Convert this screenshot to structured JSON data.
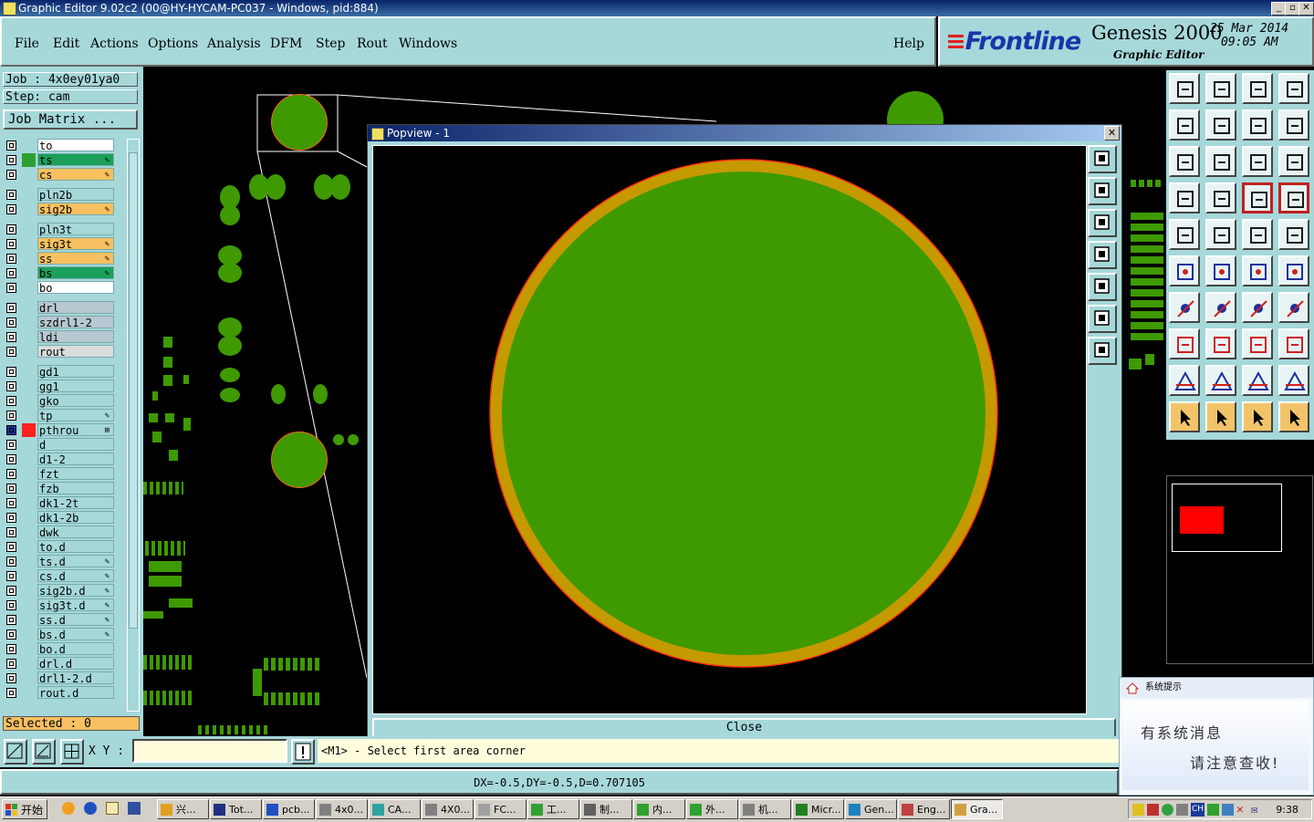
{
  "window": {
    "title": "Graphic Editor 9.02c2 (00@HY-HYCAM-PC037 - Windows, pid:884)"
  },
  "menu": [
    "File",
    "Edit",
    "Actions",
    "Options",
    "Analysis",
    "DFM",
    "Step",
    "Rout",
    "Windows"
  ],
  "help": "Help",
  "brand": {
    "logo": "Frontline",
    "product": "Genesis 2000",
    "subtitle": "Graphic Editor",
    "date": "25 Mar 2014",
    "time": "09:05 AM"
  },
  "job": {
    "job": "Job : 4x0ey01ya0",
    "step": "Step: cam",
    "matrix_button": "Job Matrix ..."
  },
  "layers": [
    {
      "name": "to",
      "color": "#ffffff",
      "swatch": "",
      "flag": ""
    },
    {
      "name": "ts",
      "color": "#1aa05a",
      "swatch": "#2aa030",
      "flag": "✎"
    },
    {
      "name": "cs",
      "color": "#f8c060",
      "swatch": "",
      "flag": "✎"
    },
    {
      "name": "pln2b",
      "color": "#a6d8da",
      "swatch": "",
      "flag": ""
    },
    {
      "name": "sig2b",
      "color": "#f8c060",
      "swatch": "",
      "flag": "✎"
    },
    {
      "name": "pln3t",
      "color": "#a6d8da",
      "swatch": "",
      "flag": ""
    },
    {
      "name": "sig3t",
      "color": "#f8c060",
      "swatch": "",
      "flag": "✎"
    },
    {
      "name": "ss",
      "color": "#f8c060",
      "swatch": "",
      "flag": "✎"
    },
    {
      "name": "bs",
      "color": "#1aa05a",
      "swatch": "",
      "flag": "✎"
    },
    {
      "name": "bo",
      "color": "#ffffff",
      "swatch": "",
      "flag": ""
    },
    {
      "name": "drl",
      "color": "#b8c8d0",
      "swatch": "",
      "flag": ""
    },
    {
      "name": "szdrl1-2",
      "color": "#b8c8d0",
      "swatch": "",
      "flag": ""
    },
    {
      "name": "ldi",
      "color": "#b8c8d0",
      "swatch": "",
      "flag": ""
    },
    {
      "name": "rout",
      "color": "#d8dcdc",
      "swatch": "",
      "flag": ""
    },
    {
      "name": "gd1",
      "color": "#a6d8da",
      "swatch": "",
      "flag": ""
    },
    {
      "name": "gg1",
      "color": "#a6d8da",
      "swatch": "",
      "flag": ""
    },
    {
      "name": "gko",
      "color": "#a6d8da",
      "swatch": "",
      "flag": ""
    },
    {
      "name": "tp",
      "color": "#a6d8da",
      "swatch": "",
      "flag": "✎"
    },
    {
      "name": "pthrou",
      "color": "#a6d8da",
      "swatch": "#ff2020",
      "flag": "⊞"
    },
    {
      "name": "d",
      "color": "#a6d8da",
      "swatch": "",
      "flag": ""
    },
    {
      "name": "d1-2",
      "color": "#a6d8da",
      "swatch": "",
      "flag": ""
    },
    {
      "name": "fzt",
      "color": "#a6d8da",
      "swatch": "",
      "flag": ""
    },
    {
      "name": "fzb",
      "color": "#a6d8da",
      "swatch": "",
      "flag": ""
    },
    {
      "name": "dk1-2t",
      "color": "#a6d8da",
      "swatch": "",
      "flag": ""
    },
    {
      "name": "dk1-2b",
      "color": "#a6d8da",
      "swatch": "",
      "flag": ""
    },
    {
      "name": "dwk",
      "color": "#a6d8da",
      "swatch": "",
      "flag": ""
    },
    {
      "name": "to.d",
      "color": "#a6d8da",
      "swatch": "",
      "flag": ""
    },
    {
      "name": "ts.d",
      "color": "#a6d8da",
      "swatch": "",
      "flag": "✎"
    },
    {
      "name": "cs.d",
      "color": "#a6d8da",
      "swatch": "",
      "flag": "✎"
    },
    {
      "name": "sig2b.d",
      "color": "#a6d8da",
      "swatch": "",
      "flag": "✎"
    },
    {
      "name": "sig3t.d",
      "color": "#a6d8da",
      "swatch": "",
      "flag": "✎"
    },
    {
      "name": "ss.d",
      "color": "#a6d8da",
      "swatch": "",
      "flag": "✎"
    },
    {
      "name": "bs.d",
      "color": "#a6d8da",
      "swatch": "",
      "flag": "✎"
    },
    {
      "name": "bo.d",
      "color": "#a6d8da",
      "swatch": "",
      "flag": ""
    },
    {
      "name": "drl.d",
      "color": "#a6d8da",
      "swatch": "",
      "flag": ""
    },
    {
      "name": "drl1-2.d",
      "color": "#a6d8da",
      "swatch": "",
      "flag": ""
    },
    {
      "name": "rout.d",
      "color": "#a6d8da",
      "swatch": "",
      "flag": ""
    }
  ],
  "selected": "Selected : 0",
  "popview": {
    "title": "Popview - 1",
    "close_label": "Close"
  },
  "command": {
    "xy_label": "X Y :",
    "xy_value": "",
    "prompt": "<M1> - Select first area corner"
  },
  "status": "DX=-0.5,DY=-0.5,D=0.707105",
  "notify": {
    "title": "系统提示",
    "line1": "有系统消息",
    "line2": "请注意查收!"
  },
  "taskbar": {
    "start": "开始",
    "items": [
      "兴...",
      "Tot...",
      "pcb...",
      "4x0...",
      "CA...",
      "4X0...",
      "FC...",
      "工...",
      "制...",
      "内...",
      "外...",
      "机...",
      "Micr...",
      "Gen...",
      "Eng...",
      "Gra..."
    ],
    "tray_ime": "CH",
    "clock": "9:38"
  },
  "colors": {
    "panel": "#a6d8da",
    "copper": "#3e9a00",
    "annular": "#c49a00",
    "highlight": "#ff0000"
  }
}
